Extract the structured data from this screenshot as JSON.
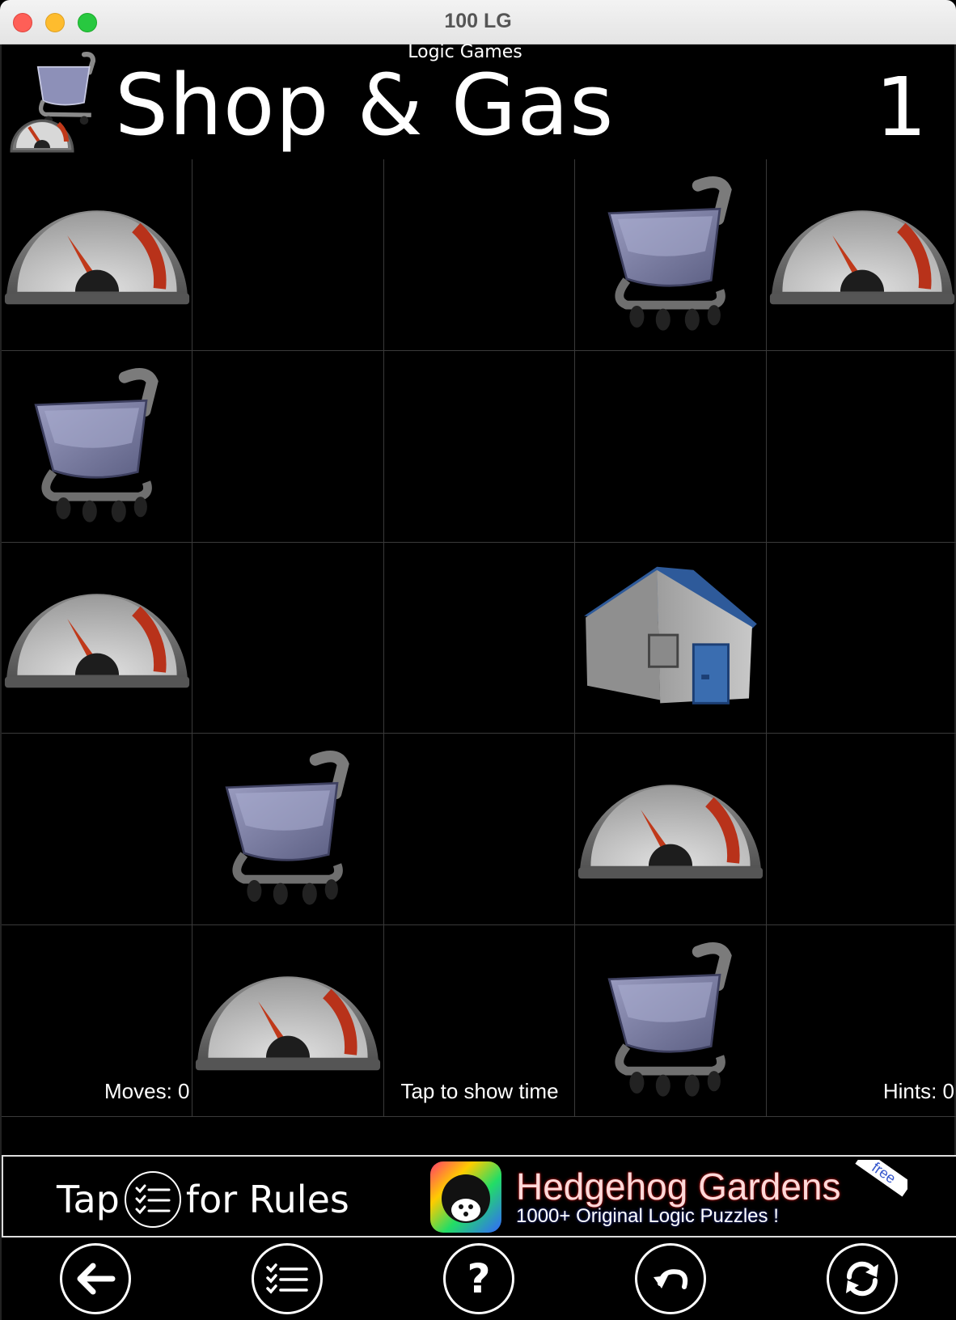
{
  "window": {
    "title": "100 LG"
  },
  "header": {
    "subtitle": "Logic Games",
    "title": "Shop & Gas",
    "level": "1",
    "logo_icon": "cart-gauge-logo-icon"
  },
  "board": {
    "rows": 5,
    "cols": 5,
    "cells": [
      [
        "gauge",
        "",
        "",
        "cart",
        "gauge"
      ],
      [
        "cart",
        "",
        "",
        "",
        ""
      ],
      [
        "gauge",
        "",
        "",
        "house",
        ""
      ],
      [
        "",
        "cart",
        "",
        "gauge",
        ""
      ],
      [
        "",
        "gauge",
        "",
        "cart",
        ""
      ]
    ]
  },
  "status": {
    "moves": "Moves: 0",
    "timer": "Tap to show time",
    "hints": "Hints: 0"
  },
  "rules_banner": {
    "tap": "Tap",
    "for_rules": "for Rules",
    "icon": "list-checks-icon"
  },
  "ad": {
    "title": "Hedgehog Gardens",
    "subtitle": "1000+ Original Logic Puzzles !",
    "badge": "free",
    "icon": "hedgehog-icon"
  },
  "toolbar": {
    "buttons": [
      "back-arrow-icon",
      "rules-list-icon",
      "help-question-icon",
      "undo-icon",
      "restart-icon"
    ],
    "help_glyph": "?"
  },
  "colors": {
    "background": "#000000",
    "grid_line": "#3a3a3a",
    "cart_body": "#6c6f8e",
    "house_roof": "#2e5a9a",
    "gauge_needle": "#c0391a"
  }
}
